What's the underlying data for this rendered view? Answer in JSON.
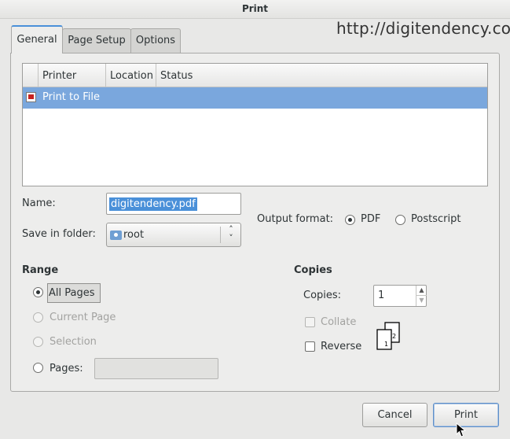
{
  "window": {
    "title": "Print"
  },
  "watermark": "http://digitendency.com",
  "tabs": [
    {
      "label": "General"
    },
    {
      "label": "Page Setup"
    },
    {
      "label": "Options"
    }
  ],
  "printer_list": {
    "columns": [
      "Printer",
      "Location",
      "Status"
    ],
    "rows": [
      {
        "printer": "Print to File",
        "icon": "print-to-file-icon"
      }
    ]
  },
  "file": {
    "name_label": "Name:",
    "name_value": "digitendency.pdf",
    "folder_label": "Save in folder:",
    "folder_value": "root",
    "output_label": "Output format:",
    "formats": [
      {
        "label": "PDF",
        "selected": true
      },
      {
        "label": "Postscript",
        "selected": false
      }
    ]
  },
  "range": {
    "heading": "Range",
    "options": [
      {
        "label": "All Pages",
        "selected": true,
        "enabled": true
      },
      {
        "label": "Current Page",
        "selected": false,
        "enabled": false
      },
      {
        "label": "Selection",
        "selected": false,
        "enabled": false
      },
      {
        "label": "Pages:",
        "selected": false,
        "enabled": true
      }
    ]
  },
  "copies": {
    "heading": "Copies",
    "copies_label": "Copies:",
    "copies_value": "1",
    "collate_label": "Collate",
    "reverse_label": "Reverse",
    "page_numbers": [
      "1",
      "2"
    ]
  },
  "buttons": {
    "cancel": "Cancel",
    "print": "Print"
  },
  "colors": {
    "selection": "#7aa7dd",
    "accent": "#4a90d9"
  }
}
